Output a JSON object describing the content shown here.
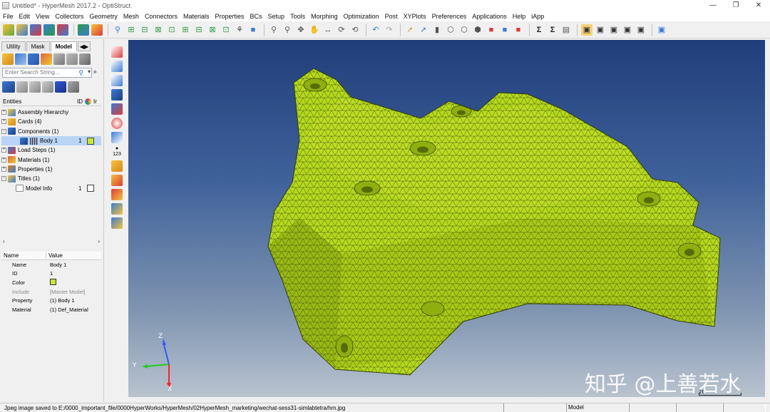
{
  "window": {
    "title": "Untitled* - HyperMesh 2017.2 - OptiStruct",
    "controls": [
      "minimize-icon",
      "restore-icon",
      "close-icon"
    ]
  },
  "menu": [
    "File",
    "Edit",
    "View",
    "Collectors",
    "Geometry",
    "Mesh",
    "Connectors",
    "Materials",
    "Properties",
    "BCs",
    "Setup",
    "Tools",
    "Morphing",
    "Optimization",
    "Post",
    "XYPlots",
    "Preferences",
    "Applications",
    "Help",
    "iApp"
  ],
  "browser": {
    "tabs": [
      "Utility",
      "Mask",
      "Model"
    ],
    "active_tab": "Model",
    "search_placeholder": "Enter Search String...",
    "entities_header": "Entities",
    "id_header": "ID",
    "tree": [
      {
        "label": "Assembly Hierarchy",
        "id": "",
        "expanded": false
      },
      {
        "label": "Cards (4)",
        "id": "",
        "expanded": false
      },
      {
        "label": "Components (1)",
        "id": "",
        "expanded": true
      },
      {
        "label": "Body 1",
        "id": "1",
        "child": true,
        "color": "#c8e63c"
      },
      {
        "label": "Load Steps (1)",
        "id": "",
        "expanded": false
      },
      {
        "label": "Materials (1)",
        "id": "",
        "expanded": false
      },
      {
        "label": "Properties (1)",
        "id": "",
        "expanded": false
      },
      {
        "label": "Titles (1)",
        "id": "",
        "expanded": true
      },
      {
        "label": "Model Info",
        "id": "1",
        "child": true,
        "color": "#ffffff"
      }
    ]
  },
  "properties": {
    "headers": [
      "Name",
      "Value"
    ],
    "rows": [
      {
        "key": "Name",
        "value": "Body 1"
      },
      {
        "key": "ID",
        "value": "1"
      },
      {
        "key": "Color",
        "value": "",
        "swatch": "#c8e63c"
      },
      {
        "key": "Include",
        "value": "[Master Model]",
        "muted": true
      },
      {
        "key": "Property",
        "value": "(1) Body 1"
      },
      {
        "key": "Material",
        "value": "(1) Def_Material"
      }
    ]
  },
  "viewport": {
    "triad": {
      "x": "X",
      "y": "Y",
      "z": "Z"
    },
    "scale_label": "20",
    "watermark": "知乎 @上善若水",
    "mesh_color": "#b5d81f"
  },
  "status": {
    "message": "Jpeg image saved to E:/0000_important_file/0000HyperWorks/HyperMesh/02HyperMesh_marketing/wechat-sess31-simlabtetra/hm.jpg",
    "cells": [
      "",
      "Model",
      "",
      "",
      ""
    ]
  }
}
